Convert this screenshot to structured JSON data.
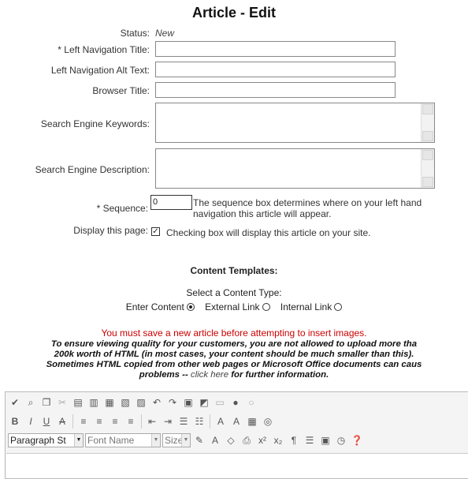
{
  "page": {
    "title": "Article - Edit"
  },
  "form": {
    "status_label": "Status:",
    "status_value": "New",
    "left_nav_title_label": "* Left Navigation Title:",
    "left_nav_alt_label": "Left Navigation Alt Text:",
    "browser_title_label": "Browser Title:",
    "keywords_label": "Search Engine Keywords:",
    "description_label": "Search Engine Description:",
    "sequence_label": "* Sequence:",
    "sequence_value": "0",
    "sequence_help_line1": "The sequence box determines where on your left hand",
    "sequence_help_line2": "navigation this article will appear.",
    "display_label": "Display this page:",
    "display_checked": true,
    "display_help": "Checking box will display this article on your site."
  },
  "templates": {
    "heading": "Content Templates:",
    "select_label": "Select a Content Type:",
    "options": [
      {
        "label": "Enter Content",
        "selected": true
      },
      {
        "label": "External Link",
        "selected": false
      },
      {
        "label": "Internal Link",
        "selected": false
      }
    ]
  },
  "warning": "You must save a new article before attempting to insert images.",
  "notice": {
    "line1": "To ensure viewing quality for your customers, you are not allowed to upload more tha",
    "line2": "200k worth of HTML (in most cases, your content should be much smaller than this).",
    "line3": "Sometimes HTML copied from other web pages or Microsoft Office documents can caus",
    "line4_before": "problems -- ",
    "link": "click here",
    "line4_after": " for further information."
  },
  "editor": {
    "format_select": "Paragraph St",
    "font_select": "Font Name",
    "size_select": "Size"
  }
}
